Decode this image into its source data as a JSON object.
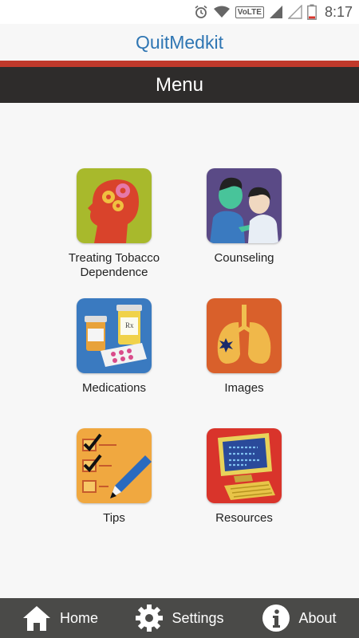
{
  "status_bar": {
    "time": "8:17",
    "network_label": "VoLTE"
  },
  "header": {
    "app_title": "QuitMedkit",
    "menu_title": "Menu"
  },
  "tiles": [
    {
      "label": "Treating Tobacco Dependence",
      "icon": "brain-gears-icon"
    },
    {
      "label": "Counseling",
      "icon": "people-talking-icon"
    },
    {
      "label": "Medications",
      "icon": "pill-bottles-icon"
    },
    {
      "label": "Images",
      "icon": "lungs-icon"
    },
    {
      "label": "Tips",
      "icon": "checklist-icon"
    },
    {
      "label": "Resources",
      "icon": "computer-icon"
    }
  ],
  "bottom_nav": [
    {
      "label": "Home",
      "icon": "home-icon"
    },
    {
      "label": "Settings",
      "icon": "gear-icon"
    },
    {
      "label": "About",
      "icon": "info-icon"
    }
  ],
  "colors": {
    "title_blue": "#2f76b3",
    "accent_red": "#c0392b",
    "menu_bar": "#2e2c2b",
    "bottom_bar": "#4a4a48"
  }
}
